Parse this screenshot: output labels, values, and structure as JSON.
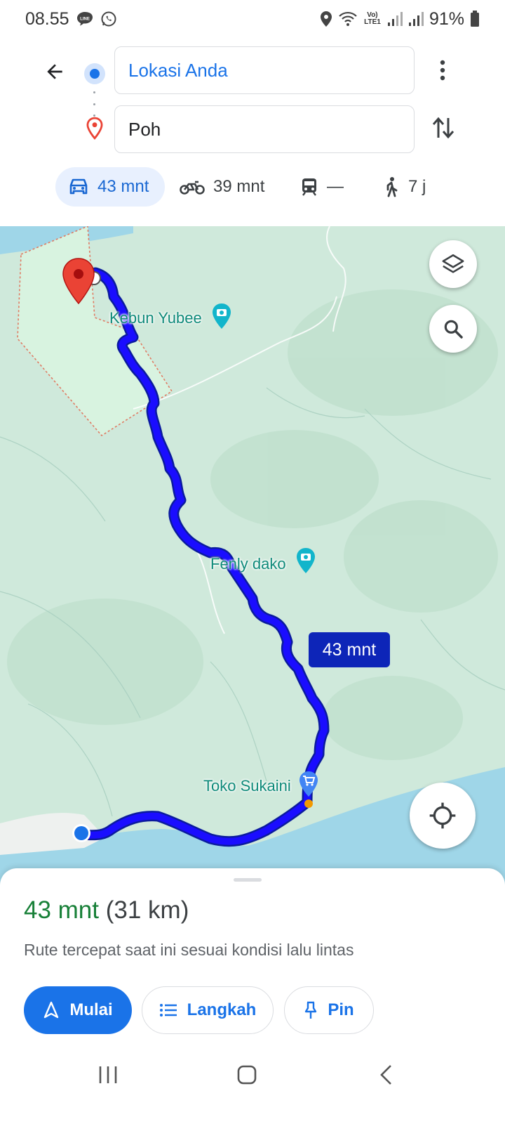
{
  "status_bar": {
    "time": "08.55",
    "battery": "91%",
    "network_label": "Vo) LTE1"
  },
  "directions": {
    "origin": "Lokasi Anda",
    "destination": "Poh"
  },
  "modes": [
    {
      "name": "driving",
      "label": "43 mnt",
      "icon": "car-icon",
      "selected": true
    },
    {
      "name": "motorcycle",
      "label": "39 mnt",
      "icon": "motorcycle-icon"
    },
    {
      "name": "transit",
      "label": "—",
      "icon": "train-icon"
    },
    {
      "name": "walking",
      "label": "7 j",
      "icon": "walk-icon"
    }
  ],
  "map": {
    "places": [
      {
        "name": "Kebun Yubee",
        "type": "photo-spot"
      },
      {
        "name": "Fenly dako",
        "type": "photo-spot"
      },
      {
        "name": "Toko Sukaini",
        "type": "shop"
      }
    ],
    "route_duration": "43 mnt",
    "colors": {
      "route": "#1a0dff",
      "water": "#9fd6e8",
      "land": "#cfe9db",
      "pin": "#ea4335"
    }
  },
  "sheet": {
    "duration": "43 mnt",
    "distance": "(31 km)",
    "subtitle": "Rute tercepat saat ini sesuai kondisi lalu lintas",
    "buttons": {
      "start": "Mulai",
      "steps": "Langkah",
      "pin": "Pin"
    }
  }
}
